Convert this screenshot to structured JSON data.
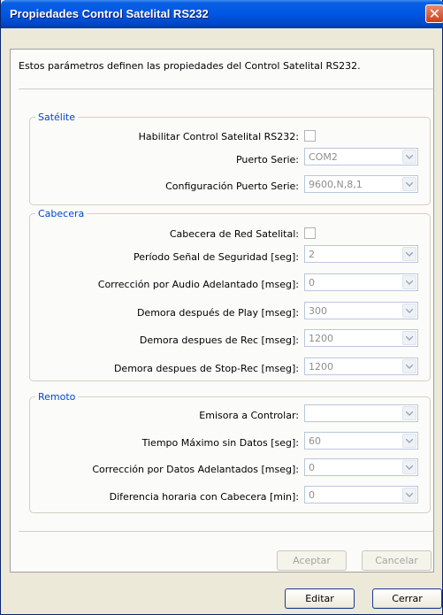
{
  "window": {
    "title": "Propiedades Control Satelital RS232"
  },
  "intro": "Estos parámetros definen las propiedades del Control Satelital RS232.",
  "satelite": {
    "legend": "Satélite",
    "enable_label": "Habilitar Control Satelital RS232:",
    "enable_checked": false,
    "port_label": "Puerto Serie:",
    "port_value": "COM2",
    "config_label": "Configuración Puerto Serie:",
    "config_value": "9600,N,8,1"
  },
  "cabecera": {
    "legend": "Cabecera",
    "header_label": "Cabecera de Red Satelital:",
    "header_checked": false,
    "period_label": "Período Señal de Seguridad [seg]:",
    "period_value": "2",
    "audio_label": "Corrección por Audio Adelantado [mseg]:",
    "audio_value": "0",
    "play_label": "Demora después de Play [mseg]:",
    "play_value": "300",
    "rec_label": "Demora despues de Rec [mseg]:",
    "rec_value": "1200",
    "stoprec_label": "Demora despues de Stop-Rec [mseg]:",
    "stoprec_value": "1200"
  },
  "remoto": {
    "legend": "Remoto",
    "station_label": "Emisora a Controlar:",
    "station_value": "",
    "maxtime_label": "Tiempo Máximo sin Datos [seg]:",
    "maxtime_value": "60",
    "datacorr_label": "Corrección por Datos Adelantados [mseg]:",
    "datacorr_value": "0",
    "timediff_label": "Diferencia horaria con Cabecera [min]:",
    "timediff_value": "0"
  },
  "buttons": {
    "accept": "Aceptar",
    "cancel": "Cancelar",
    "edit": "Editar",
    "close": "Cerrar"
  },
  "icons": {
    "close": "close-icon",
    "dropdown": "chevron-down-icon"
  },
  "colors": {
    "titlebar": "#0058e6",
    "legend": "#0046d5",
    "disabled_text": "#a4a4a4"
  }
}
